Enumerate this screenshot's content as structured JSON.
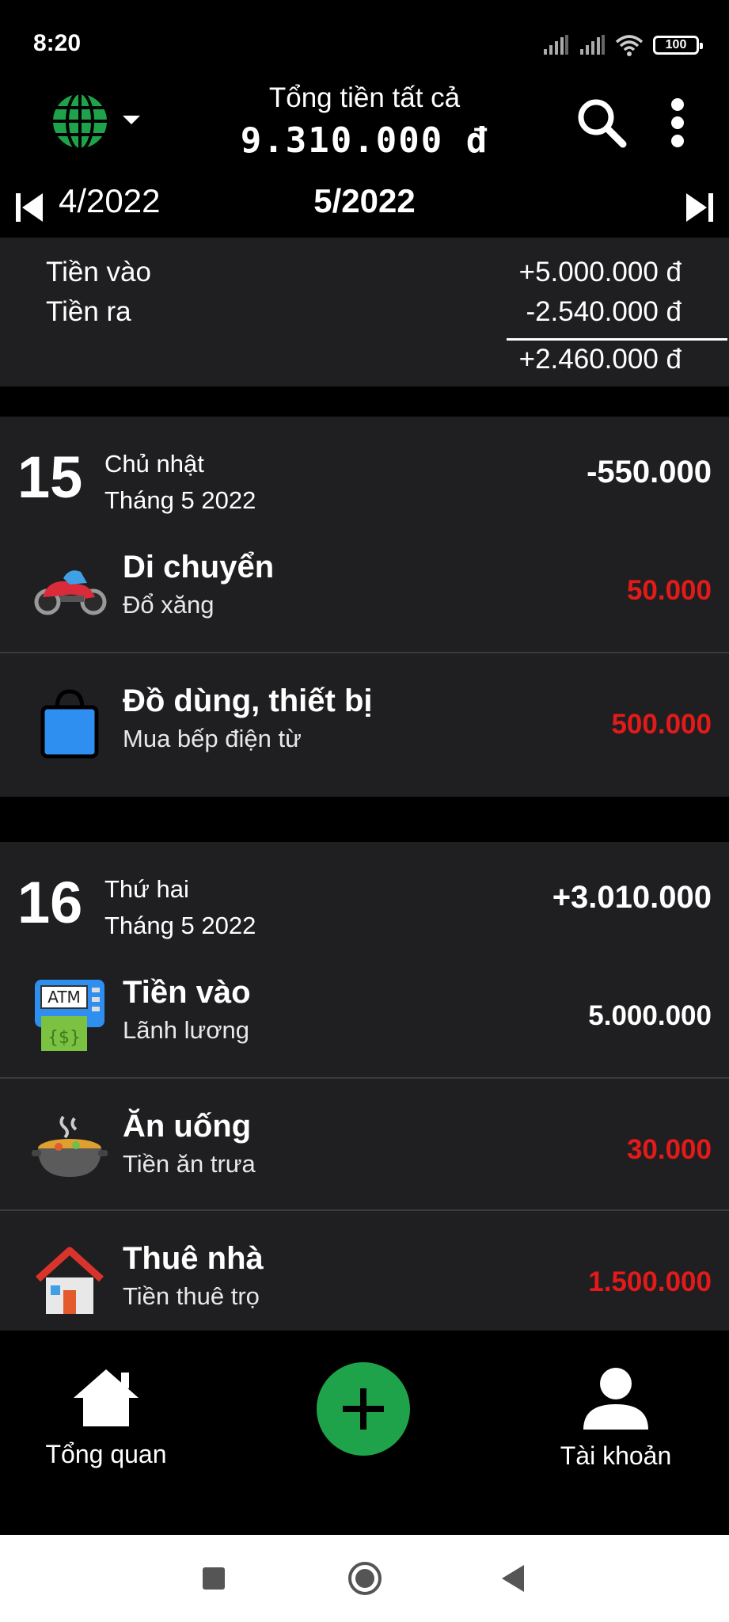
{
  "status_bar": {
    "time": "8:20",
    "battery": "100"
  },
  "header": {
    "title": "Tổng tiền tất cả",
    "total": "9.310.000 đ",
    "language_icon": "globe-icon",
    "search_icon": "search-icon",
    "menu_icon": "more-vert-icon"
  },
  "month_nav": {
    "previous": "4/2022",
    "current": "5/2022"
  },
  "summary": {
    "income_label": "Tiền vào",
    "income_value": "+5.000.000 đ",
    "expense_label": "Tiền ra",
    "expense_value": "-2.540.000 đ",
    "net_value": "+2.460.000 đ"
  },
  "days": [
    {
      "day": "15",
      "weekday": "Chủ nhật",
      "month": "Tháng 5 2022",
      "total": "-550.000",
      "transactions": [
        {
          "icon": "motorbike-icon",
          "category": "Di chuyển",
          "note": "Đổ xăng",
          "amount": "50.000",
          "type": "expense"
        },
        {
          "icon": "shopping-bag-icon",
          "category": "Đồ dùng, thiết bị",
          "note": "Mua bếp điện từ",
          "amount": "500.000",
          "type": "expense"
        }
      ]
    },
    {
      "day": "16",
      "weekday": "Thứ hai",
      "month": "Tháng 5 2022",
      "total": "+3.010.000",
      "transactions": [
        {
          "icon": "atm-icon",
          "category": "Tiền vào",
          "note": "Lãnh lương",
          "amount": "5.000.000",
          "type": "income"
        },
        {
          "icon": "food-pot-icon",
          "category": "Ăn uống",
          "note": "Tiền ăn trưa",
          "amount": "30.000",
          "type": "expense"
        },
        {
          "icon": "house-icon",
          "category": "Thuê nhà",
          "note": "Tiền thuê trọ",
          "amount": "1.500.000",
          "type": "expense"
        }
      ]
    }
  ],
  "bottom_nav": {
    "overview_label": "Tổng quan",
    "add_icon": "plus-icon",
    "account_label": "Tài khoản"
  },
  "colors": {
    "expense": "#e31a1a",
    "fab": "#1fa34a",
    "card_bg": "#1f1f21"
  }
}
